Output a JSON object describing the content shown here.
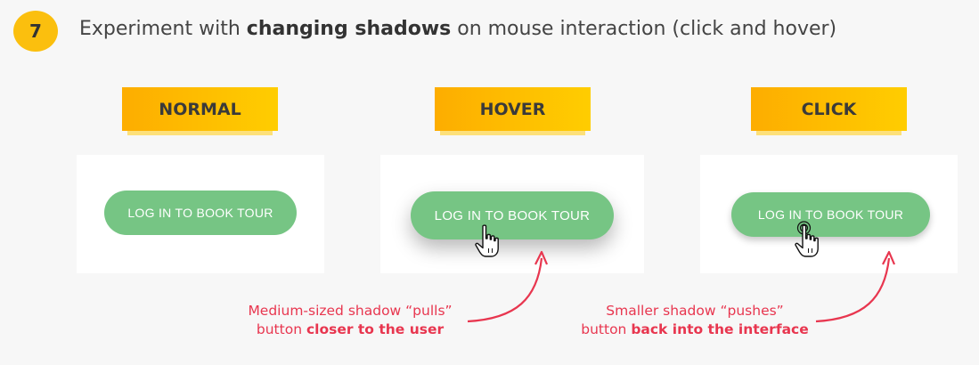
{
  "step": {
    "number": "7"
  },
  "heading": {
    "prefix": "Experiment with ",
    "emphasis": "changing shadows",
    "suffix": " on mouse interaction (click and hover)"
  },
  "states": [
    {
      "label": "NORMAL",
      "button_text": "LOG IN TO BOOK TOUR"
    },
    {
      "label": "HOVER",
      "button_text": "LOG IN TO BOOK TOUR"
    },
    {
      "label": "CLICK",
      "button_text": "LOG IN TO BOOK TOUR"
    }
  ],
  "notes": {
    "hover": {
      "line1": "Medium-sized shadow “pulls”",
      "line2_prefix": "button ",
      "line2_bold": "closer to the user"
    },
    "click": {
      "line1": "Smaller shadow “pushes”",
      "line2_prefix": "button ",
      "line2_bold": "back into the interface"
    }
  },
  "colors": {
    "badge": "#fbbf0e",
    "tag_gradient_start": "#fdad00",
    "tag_gradient_end": "#ffcd00",
    "button": "#76c584",
    "annotation": "#e8364f"
  },
  "icons": {
    "hover_cursor": "pointer-hand-icon",
    "click_cursor": "pointer-hand-click-icon",
    "arrows": "curved-arrow-icon"
  }
}
